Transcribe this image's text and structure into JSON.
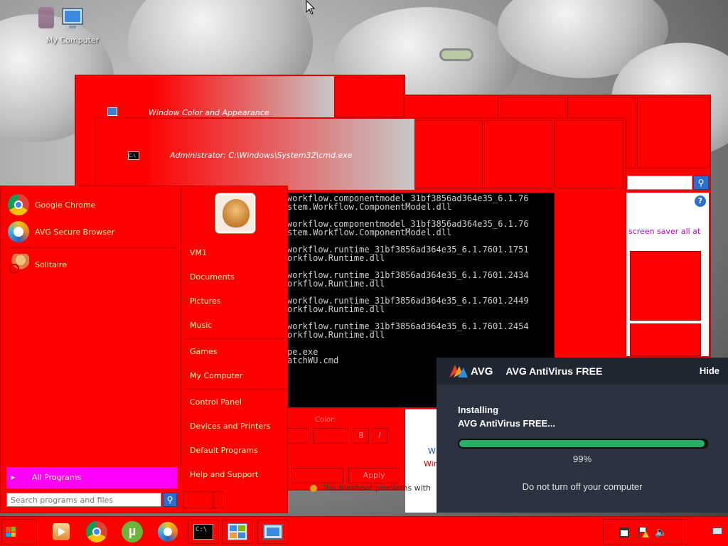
{
  "desktop": {
    "icons": [
      {
        "label": "My Computer",
        "icon": "computer-icon"
      }
    ]
  },
  "windows": {
    "appearance": {
      "title": "Window Color and Appearance"
    },
    "cmd": {
      "title": "Administrator: C:\\Windows\\System32\\cmd.exe",
      "lines": [
        "workflow.componentmodel_31bf3856ad364e35_6.1.76",
        "stem.Workflow.ComponentModel.dll",
        "",
        "workflow.componentmodel_31bf3856ad364e35_6.1.76",
        "stem.Workflow.ComponentModel.dll",
        "",
        "workflow.runtime_31bf3856ad364e35_6.1.7601.1751",
        "orkflow.Runtime.dll",
        "",
        "workflow.runtime_31bf3856ad364e35_6.1.7601.2434",
        "orkflow.Runtime.dll",
        "",
        "workflow.runtime_31bf3856ad364e35_6.1.7601.2449",
        "orkflow.Runtime.dll",
        "",
        "workflow.runtime_31bf3856ad364e35_6.1.7601.2454",
        "orkflow.Runtime.dll",
        "",
        "pe.exe",
        "atchWU.cmd"
      ]
    },
    "back_dialog": {
      "help_text": "screen saver all at",
      "color_label": "Color:",
      "bold_btn": "B",
      "italic_btn": "I",
      "apply_btn": "Apply",
      "text_w": "W",
      "text_win": "Win",
      "text_troubleshoot": "Troubleshoot problems with"
    }
  },
  "start_menu": {
    "pinned": [
      {
        "label": "Google Chrome",
        "icon": "chrome-icon"
      },
      {
        "label": "AVG Secure Browser",
        "icon": "avg-browser-icon"
      }
    ],
    "recent": [
      {
        "label": "Solitaire",
        "icon": "solitaire-icon"
      }
    ],
    "all_programs": "All Programs",
    "search_placeholder": "Search programs and files",
    "right_items": [
      "VM1",
      "Documents",
      "Pictures",
      "Music",
      "Games",
      "My Computer",
      "Control Panel",
      "Devices and Printers",
      "Default Programs",
      "Help and Support"
    ]
  },
  "avg": {
    "brand": "AVG",
    "title": "AVG AntiVirus FREE",
    "hide": "Hide",
    "status_line1": "Installing",
    "status_line2": "AVG AntiVirus FREE...",
    "progress": 0.99,
    "progress_text": "99%",
    "warning": "Do not turn off your computer"
  },
  "taskbar": {
    "apps": [
      "media-player-icon",
      "chrome-icon",
      "utorrent-icon",
      "avg-browser-icon",
      "cmd-icon",
      "control-panel-icon",
      "display-settings-icon"
    ],
    "tray": [
      "network-icon",
      "action-center-flag-icon",
      "volume-icon"
    ]
  },
  "colors": {
    "window_red": "#ff0000",
    "avg_panel": "#2b3340",
    "avg_progress": "#29b067",
    "all_programs_bg": "#ff00ff"
  }
}
